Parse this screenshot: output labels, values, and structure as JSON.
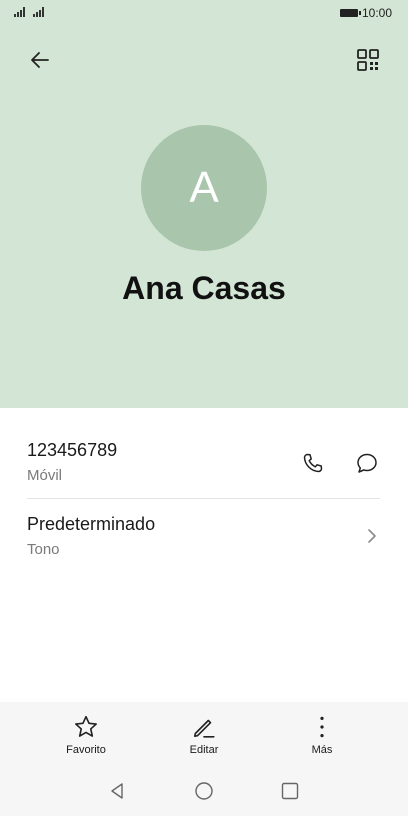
{
  "status_bar": {
    "time": "10:00"
  },
  "header": {
    "avatar_letter": "A",
    "name": "Ana Casas"
  },
  "phone_row": {
    "number": "123456789",
    "label": "Móvil"
  },
  "ringtone_row": {
    "value": "Predeterminado",
    "label": "Tono"
  },
  "actions": {
    "favorite_label": "Favorito",
    "edit_label": "Editar",
    "more_label": "Más"
  },
  "colors": {
    "header_bg": "#d3e5d4",
    "avatar_bg": "#a9c6ac",
    "bottom_bar_bg": "#f6f6f6"
  },
  "icons": [
    "back-arrow-icon",
    "qr-code-icon",
    "phone-icon",
    "message-icon",
    "chevron-right-icon",
    "star-icon",
    "pencil-icon",
    "more-vertical-icon"
  ]
}
